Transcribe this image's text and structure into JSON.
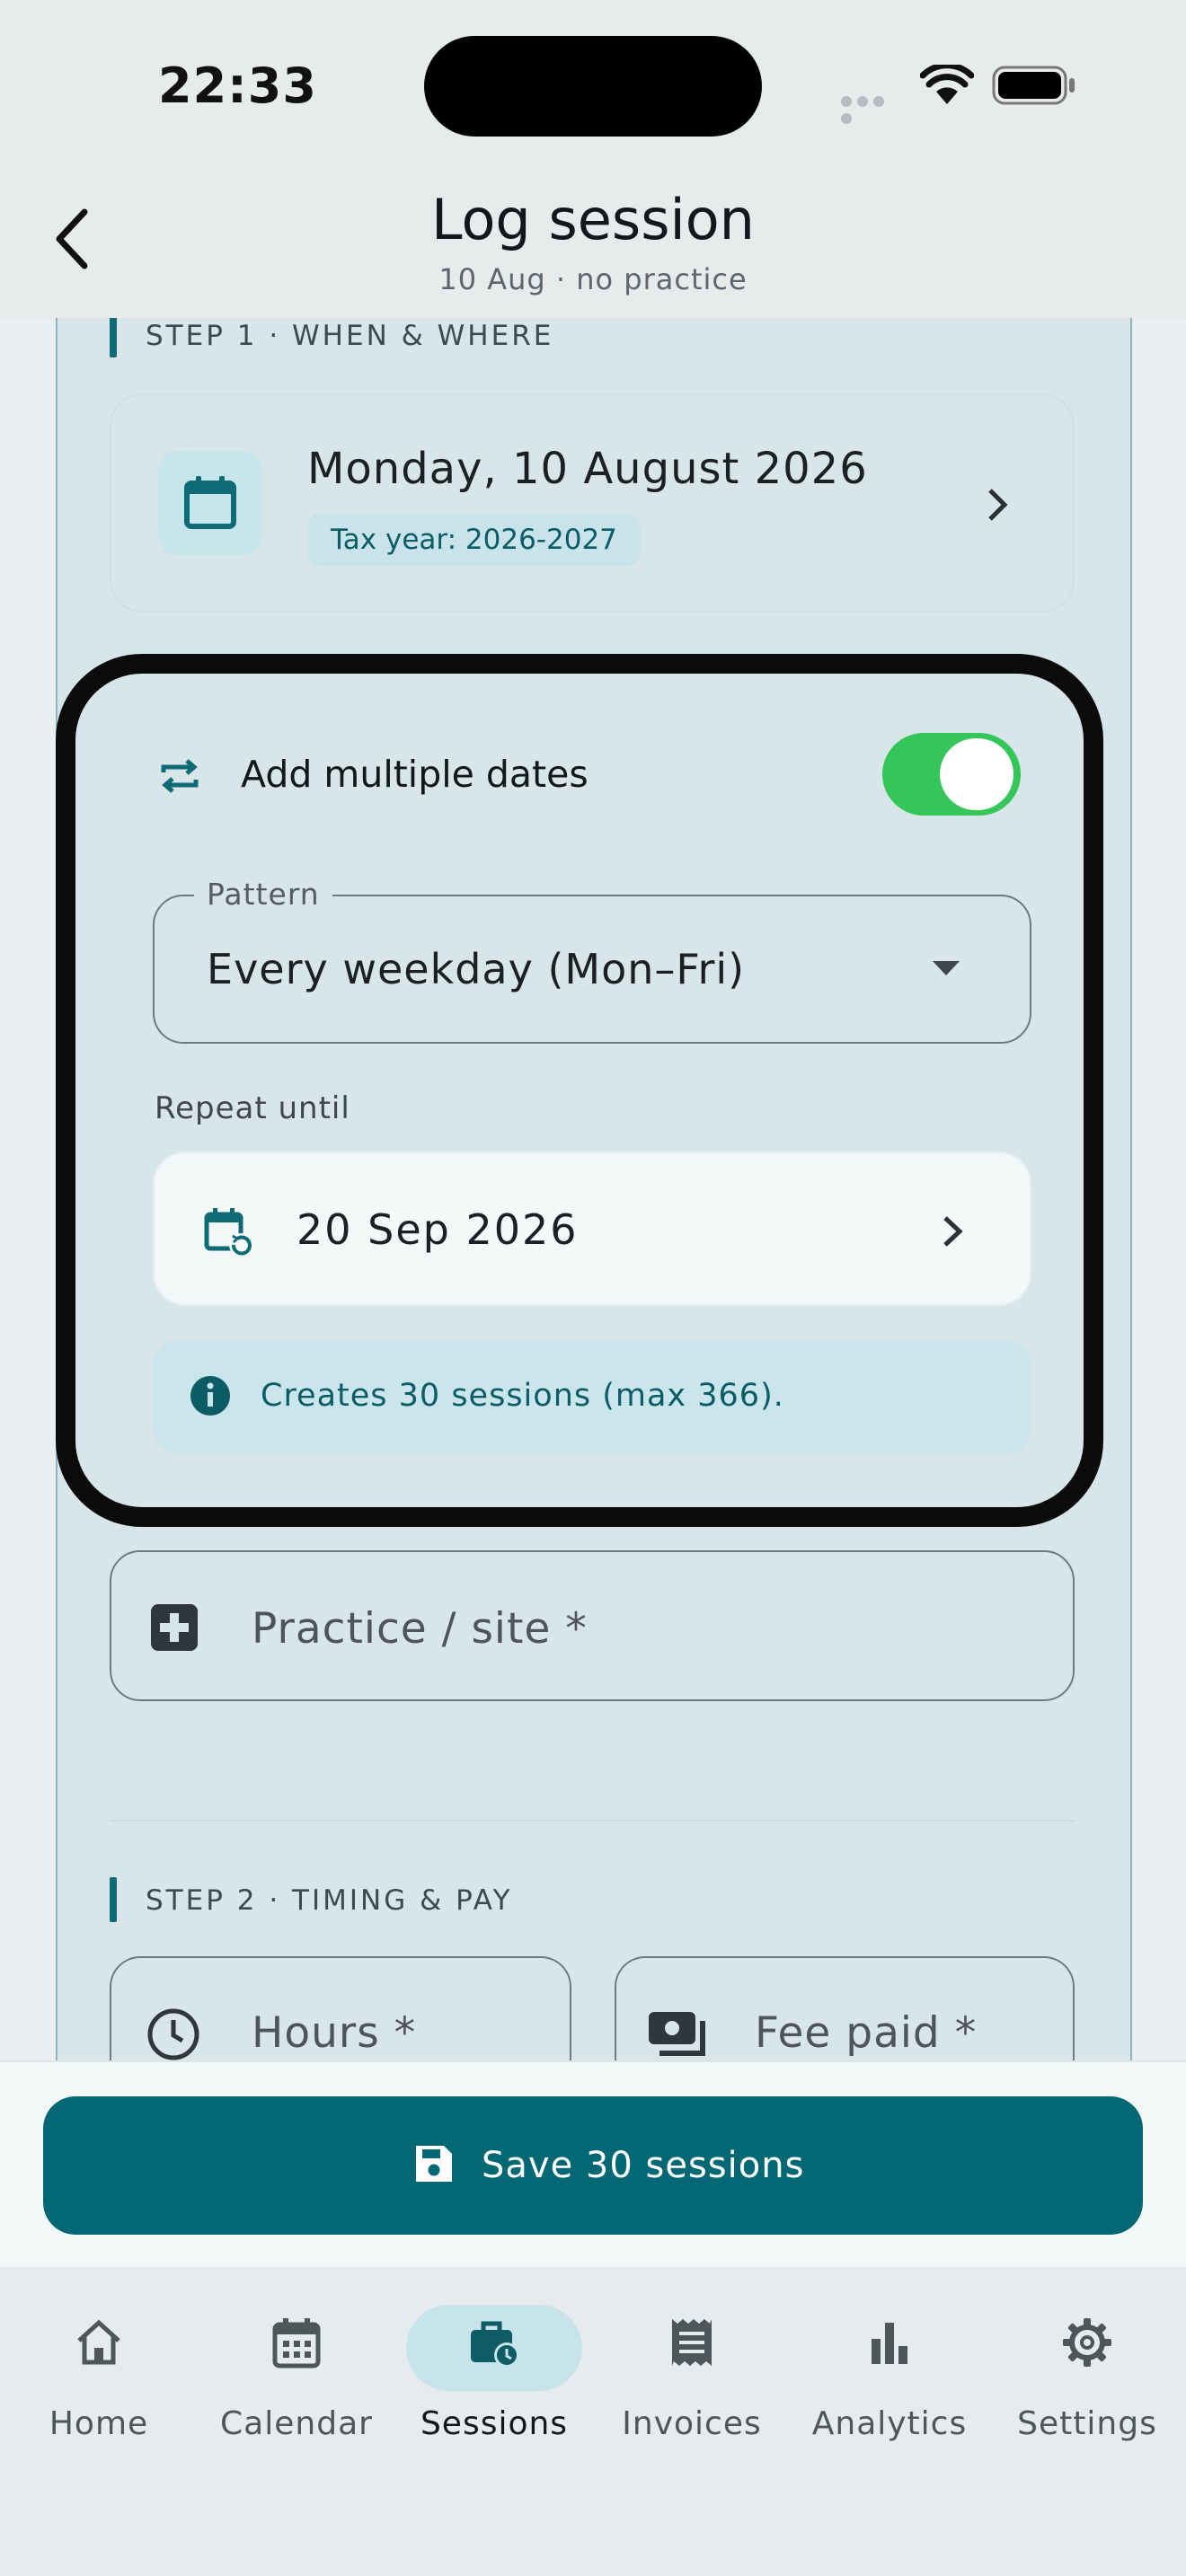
{
  "status_bar": {
    "time": "22:33"
  },
  "header": {
    "title": "Log session",
    "subtitle": "10 Aug · no practice",
    "back_icon": "chevron-left-icon"
  },
  "step1": {
    "label": "STEP 1 · WHEN & WHERE",
    "date": "Monday, 10 August 2026",
    "tax_year": "Tax year: 2026-2027"
  },
  "multiple_dates": {
    "label": "Add multiple dates",
    "enabled": true,
    "pattern_label": "Pattern",
    "pattern_value": "Every weekday (Mon–Fri)",
    "repeat_until_label": "Repeat until",
    "repeat_until_value": "20 Sep 2026",
    "info": "Creates 30 sessions (max 366)."
  },
  "practice_field": {
    "placeholder": "Practice / site *"
  },
  "step2": {
    "label": "STEP 2 · TIMING & PAY",
    "hours_placeholder": "Hours *",
    "fee_placeholder": "Fee paid *"
  },
  "save_button": {
    "label": "Save 30 sessions"
  },
  "nav": [
    {
      "label": "Home",
      "icon": "home-icon"
    },
    {
      "label": "Calendar",
      "icon": "calendar-icon"
    },
    {
      "label": "Sessions",
      "icon": "briefcase-clock-icon",
      "active": true
    },
    {
      "label": "Invoices",
      "icon": "receipt-icon"
    },
    {
      "label": "Analytics",
      "icon": "bar-chart-icon"
    },
    {
      "label": "Settings",
      "icon": "gear-icon"
    }
  ],
  "colors": {
    "primary": "#026873",
    "toggle_on": "#34c659",
    "chip_bg": "#c8e4ea",
    "card_bg": "#d9e6e9"
  }
}
